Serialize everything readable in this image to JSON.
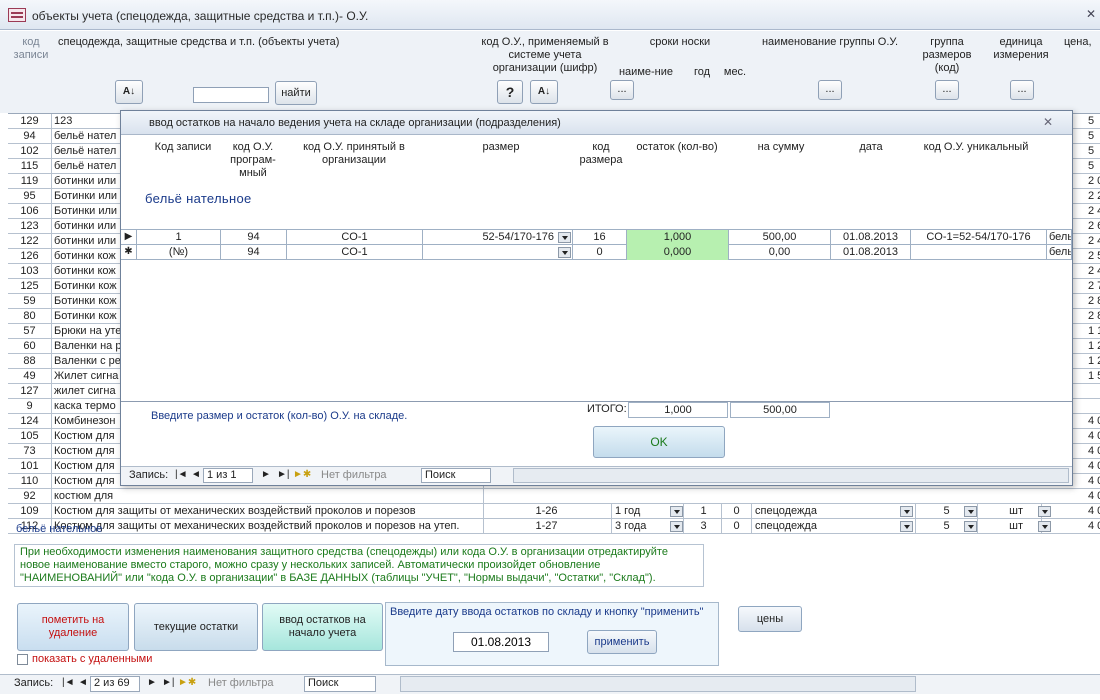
{
  "window": {
    "title": "объекты учета (спецодежда, защитные средства и т.п.)- О.У."
  },
  "header": {
    "col_code": "код записи",
    "col_name": "спецодежда, защитные средства и т.п. (объекты учета)",
    "col_org_code": "код О.У., применяемый в системе учета организации (шифр)",
    "col_terms": "сроки носки",
    "col_term_name": "наиме-ние",
    "col_year": "год",
    "col_month": "мес.",
    "col_group": "наименование группы О.У.",
    "col_size_group": "группа размеров (код)",
    "col_unit": "единица измерения",
    "col_price": "цена,",
    "find_button": "найти",
    "help_icon_label": "?",
    "dots": "...",
    "search_value": ""
  },
  "grid_rows": [
    {
      "code": "129",
      "name": "123",
      "right": "5"
    },
    {
      "code": "94",
      "name": "бельё  нател",
      "right": "5"
    },
    {
      "code": "102",
      "name": "бельё  нател",
      "right": "5"
    },
    {
      "code": "115",
      "name": "бельё  нател",
      "right": "5"
    },
    {
      "code": "119",
      "name": "ботинки или",
      "right": "2 0"
    },
    {
      "code": "95",
      "name": "Ботинки или",
      "right": "2 2"
    },
    {
      "code": "106",
      "name": "Ботинки или",
      "right": "2 4"
    },
    {
      "code": "123",
      "name": "ботинки или",
      "right": "2 6"
    },
    {
      "code": "122",
      "name": "ботинки или",
      "right": "2 4"
    },
    {
      "code": "126",
      "name": "ботинки кож",
      "right": "2 5"
    },
    {
      "code": "103",
      "name": "ботинки кож",
      "right": "2 4"
    },
    {
      "code": "125",
      "name": "Ботинки кож",
      "right": "2 7"
    },
    {
      "code": "59",
      "name": "Ботинки кож",
      "right": "2 8"
    },
    {
      "code": "80",
      "name": "Ботинки кож",
      "right": "2 8"
    },
    {
      "code": "57",
      "name": "Брюки на утеп",
      "right": "1 1"
    },
    {
      "code": "60",
      "name": "Валенки на р",
      "right": "1 2"
    },
    {
      "code": "88",
      "name": "Валенки с ре",
      "right": "1 2"
    },
    {
      "code": "49",
      "name": "Жилет сигна",
      "right": "1 5"
    },
    {
      "code": "127",
      "name": "жилет сигна",
      "right": ""
    },
    {
      "code": "9",
      "name": "каска термо",
      "right": ""
    },
    {
      "code": "124",
      "name": "Комбинезон",
      "right": "4 0"
    },
    {
      "code": "105",
      "name": "Костюм для",
      "right": "4 0"
    },
    {
      "code": "73",
      "name": "Костюм для",
      "right": "4 0"
    },
    {
      "code": "101",
      "name": "Костюм для",
      "right": "4 0"
    },
    {
      "code": "110",
      "name": "Костюм для",
      "right": "4 0"
    },
    {
      "code": "92",
      "name": "костюм для",
      "right": "4 0"
    }
  ],
  "full_rows": [
    {
      "code": "109",
      "name": "Костюм для защиты от механических воздействий проколов и порезов",
      "org_code": "1-26",
      "term": "1 год",
      "year": "1",
      "month": "0",
      "group": "спецодежда",
      "size_group": "5",
      "unit": "шт",
      "price": "4 0"
    },
    {
      "code": "112",
      "name": "Костюм для защиты от механических воздействий проколов и порезов на утеп.",
      "org_code": "1-27",
      "term": "3 года",
      "year": "3",
      "month": "0",
      "group": "спецодежда",
      "size_group": "5",
      "unit": "шт",
      "price": "4 0"
    }
  ],
  "selected_name": "бельё  нательное",
  "info_text": "При необходимости изменения наименования защитного средства (спецодежды) или кода О.У. в организации отредактируйте новое наименование вместо старого, можно сразу у нескольких записей. Автоматически произойдет  обновление \"НАИМЕНОВАНИЙ\"  или \"кода О.У. в организации\" в БАЗЕ ДАННЫХ (таблицы \"УЧЕТ\", \"Нормы выдачи\", \"Остатки\", \"Склад\").",
  "buttons": {
    "mark_deleted": "пометить на удаление",
    "current_balances": "текущие остатки",
    "input_balances": "ввод остатков на начало учета",
    "show_deleted": "показать с удаленными",
    "prices": "цены",
    "apply": "применить",
    "date_prompt": "Введите дату ввода остатков по складу и кнопку \"применить\"",
    "date_value": "01.08.2013"
  },
  "main_nav": {
    "label": "Запись:",
    "position": "2 из 69",
    "filter": "Нет фильтра",
    "search": "Поиск"
  },
  "dialog": {
    "title": "ввод остатков на начало ведения учета на складе организации (подразделения)",
    "columns": {
      "code": "Код записи",
      "prog_code": "код О.У. програм-мный",
      "org_code": "код О.У. принятый в организации",
      "size": "размер",
      "size_code": "код размера",
      "balance": "остаток (кол-во)",
      "sum": "на сумму",
      "date": "дата",
      "unique_code": "код О.У. уникальный"
    },
    "item_name": "бельё  нательное",
    "rows": [
      {
        "code": "1",
        "prog_code": "94",
        "org_code": "CO-1",
        "size": "52-54/170-176",
        "size_code": "16",
        "balance": "1,000",
        "sum": "500,00",
        "date": "01.08.2013",
        "unique_code": "CO-1=52-54/170-176",
        "extra": "бель"
      },
      {
        "code": "(№)",
        "prog_code": "94",
        "org_code": "CO-1",
        "size": "",
        "size_code": "0",
        "balance": "0,000",
        "sum": "0,00",
        "date": "01.08.2013",
        "unique_code": "",
        "extra": "бель"
      }
    ],
    "hint": "Введите размер и остаток (кол-во)  О.У. на складе.",
    "total_label": "ИТОГО:",
    "total_qty": "1,000",
    "total_sum": "500,00",
    "ok": "OK",
    "nav": {
      "label": "Запись:",
      "position": "1 из 1",
      "filter": "Нет фильтра",
      "search": "Поиск"
    }
  }
}
